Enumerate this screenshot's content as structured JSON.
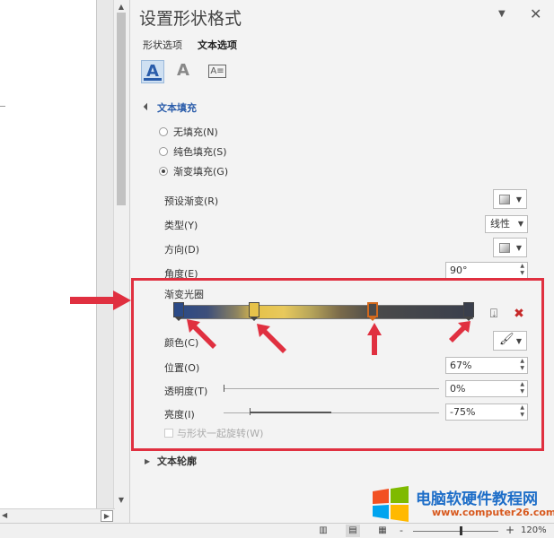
{
  "pane": {
    "title": "设置形状格式",
    "tabs": [
      "形状选项",
      "文本选项"
    ],
    "icons": [
      "text-fill-outline-icon",
      "text-effects-icon",
      "textbox-icon"
    ]
  },
  "text_fill": {
    "section_label": "文本填充",
    "options": [
      {
        "label": "无填充(N)",
        "checked": false
      },
      {
        "label": "纯色填充(S)",
        "checked": false
      },
      {
        "label": "渐变填充(G)",
        "checked": true
      }
    ],
    "preset_label": "预设渐变(R)",
    "type_label": "类型(Y)",
    "type_value": "线性",
    "direction_label": "方向(D)",
    "angle_label": "角度(E)",
    "angle_value": "90°",
    "gradient_stops_label": "渐变光圈",
    "color_label": "颜色(C)",
    "position_label": "位置(O)",
    "position_value": "67%",
    "transparency_label": "透明度(T)",
    "transparency_value": "0%",
    "brightness_label": "亮度(I)",
    "brightness_value": "-75%",
    "rotate_label": "与形状一起旋转(W)"
  },
  "text_outline": {
    "section_label": "文本轮廓"
  },
  "status_bar": {
    "zoom_level": "120%",
    "zoom_minus": "-",
    "zoom_plus": "+"
  },
  "watermark": {
    "title": "电脑软硬件教程网",
    "url": "www.computer26.com"
  },
  "colors": {
    "highlight": "#e03040",
    "accent": "#2a5caa"
  }
}
